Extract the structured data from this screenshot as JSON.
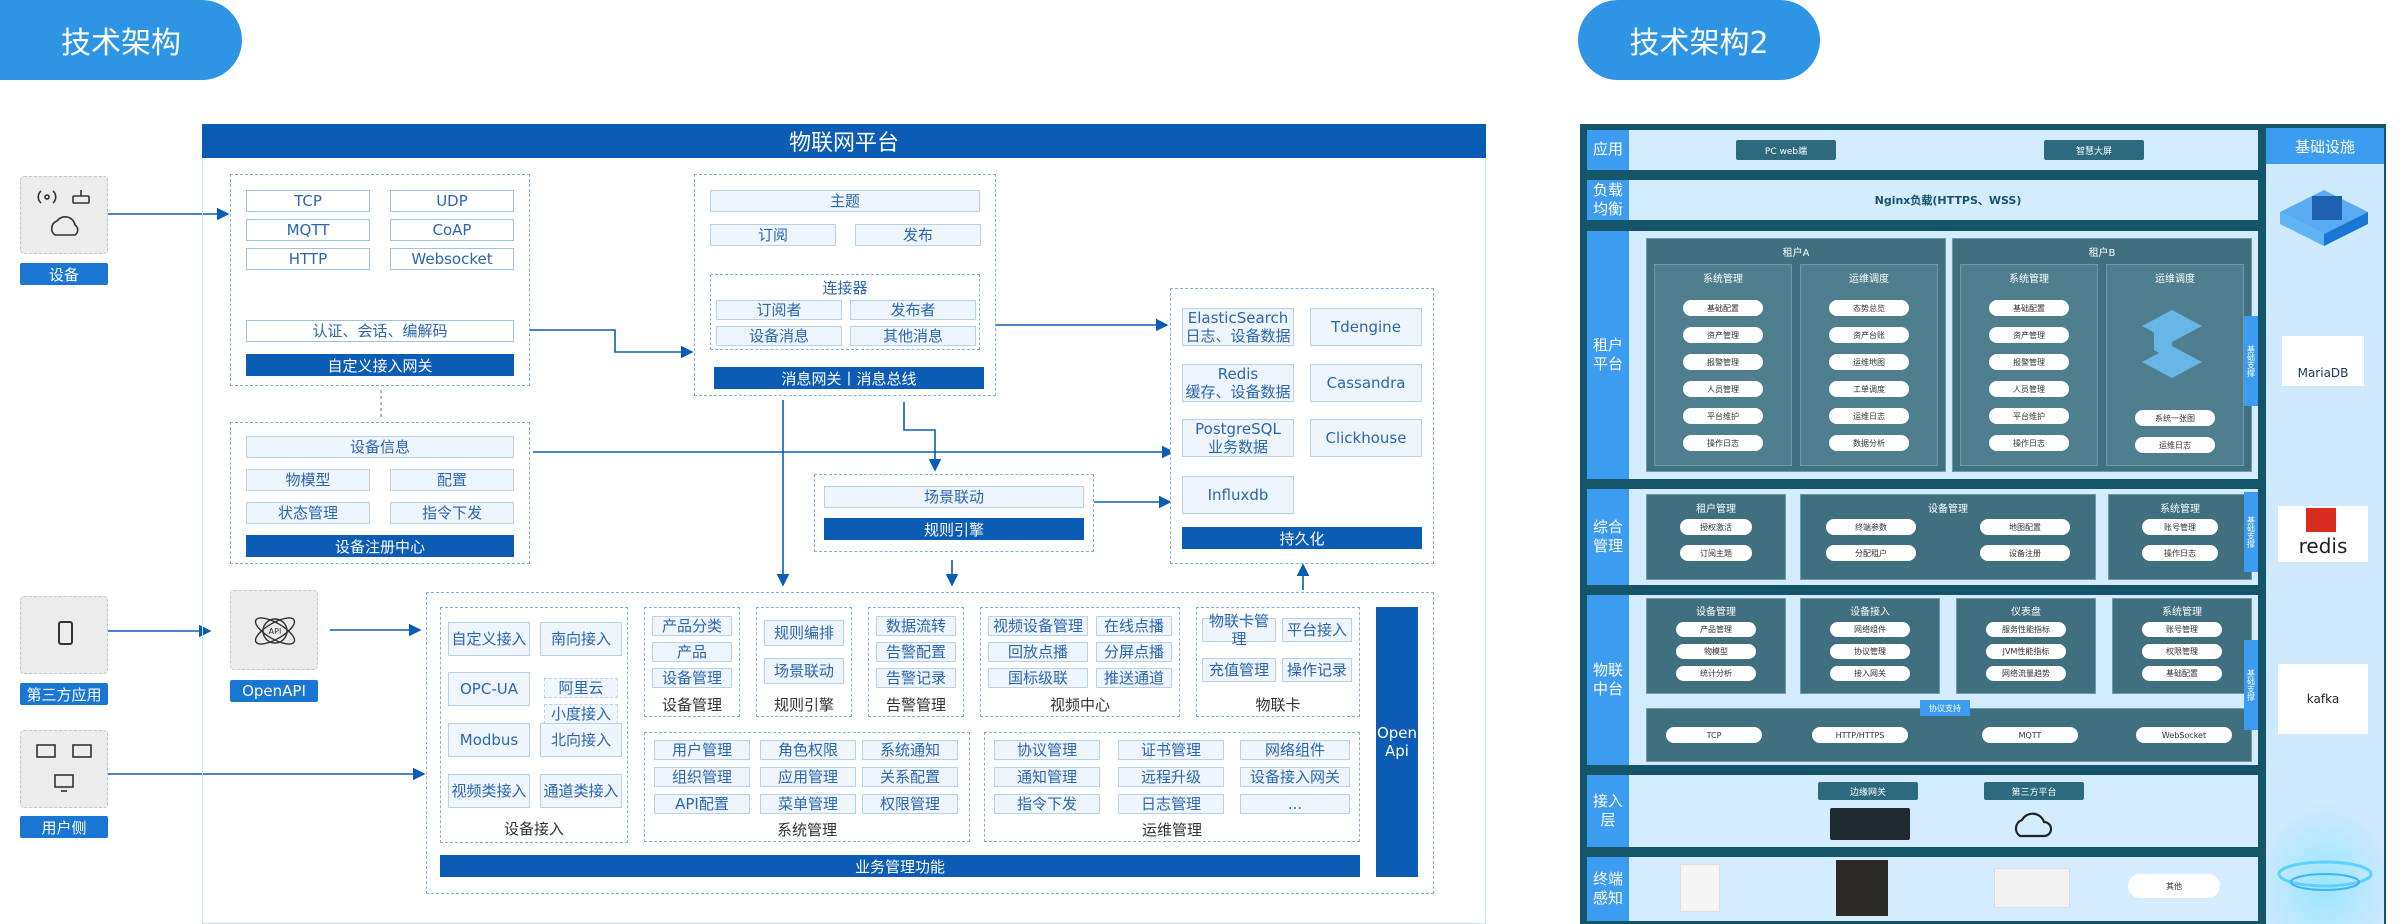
{
  "titles": {
    "left": "技术架构",
    "right": "技术架构2"
  },
  "left": {
    "platform": "物联网平台",
    "devices": {
      "device": "设备",
      "third": "第三方应用",
      "user": "用户侧",
      "openapi": "OpenAPI"
    },
    "gateway": {
      "tcp": "TCP",
      "udp": "UDP",
      "mqtt": "MQTT",
      "coap": "CoAP",
      "http": "HTTP",
      "ws": "Websocket",
      "auth": "认证、会话、编解码",
      "bar": "自定义接入网关"
    },
    "registry": {
      "info": "设备信息",
      "model": "物模型",
      "config": "配置",
      "state": "状态管理",
      "cmd": "指令下发",
      "bar": "设备注册中心"
    },
    "bus": {
      "topic": "主题",
      "sub": "订阅",
      "pub": "发布",
      "conn": "连接器",
      "subscriber": "订阅者",
      "publisher": "发布者",
      "devmsg": "设备消息",
      "other": "其他消息",
      "bar": "消息网关丨消息总线"
    },
    "rule": {
      "link": "场景联动",
      "bar": "规则引擎"
    },
    "persist": {
      "es": "ElasticSearch\n日志、设备数据",
      "td": "Tdengine",
      "redis": "Redis\n缓存、设备数据",
      "cass": "Cassandra",
      "pg": "PostgreSQL\n业务数据",
      "ch": "Clickhouse",
      "influx": "Influxdb",
      "bar": "持久化"
    },
    "access": {
      "custom": "自定义接入",
      "south": "南向接入",
      "opc": "OPC-UA",
      "ali": "阿里云",
      "baidu": "小度接入",
      "modbus": "Modbus",
      "north": "北向接入",
      "video": "视频类接入",
      "channel": "通道类接入",
      "cap": "设备接入"
    },
    "devmgmt": {
      "a": "产品分类",
      "b": "产品",
      "c": "设备管理",
      "cap": "设备管理"
    },
    "ruleeng": {
      "a": "规则编排",
      "b": "场景联动",
      "cap": "规则引擎"
    },
    "alarm": {
      "a": "数据流转",
      "b": "告警配置",
      "c": "告警记录",
      "cap": "告警管理"
    },
    "vcenter": {
      "a": "视频设备管理",
      "b": "在线点播",
      "c": "回放点播",
      "d": "分屏点播",
      "e": "国标级联",
      "f": "推送通道",
      "cap": "视频中心"
    },
    "card": {
      "a": "物联卡管理",
      "b": "平台接入",
      "c": "充值管理",
      "d": "操作记录",
      "cap": "物联卡"
    },
    "sys": {
      "a": "用户管理",
      "b": "角色权限",
      "c": "系统通知",
      "d": "组织管理",
      "e": "应用管理",
      "f": "关系配置",
      "g": "API配置",
      "h": "菜单管理",
      "i": "权限管理",
      "cap": "系统管理"
    },
    "ops": {
      "a": "协议管理",
      "b": "证书管理",
      "c": "网络组件",
      "d": "通知管理",
      "e": "远程升级",
      "f": "设备接入网关",
      "g": "指令下发",
      "h": "日志管理",
      "i": "...",
      "cap": "运维管理"
    },
    "openapi_bar": "Open\nApi",
    "biz_bar": "业务管理功能"
  },
  "right": {
    "infra": "基础设施",
    "rows": {
      "app": "应用",
      "lb": "负载\n均衡",
      "tenant": "租户\n平台",
      "mgmt": "综合\n管理",
      "iot": "物联\n中台",
      "access": "接入\n层",
      "sense": "终端\n感知"
    },
    "app": {
      "pc": "PC web端",
      "screen": "智慧大屏"
    },
    "lb": "Nginx负载(HTTPS、WSS)",
    "tenantA": "租户A",
    "tenantB": "租户B",
    "sysmgmt": "系统管理",
    "opsmgmt": "运维调度",
    "sysItems": [
      "基础配置",
      "资产管理",
      "报警管理",
      "人员管理",
      "平台维护",
      "操作日志"
    ],
    "opsItems": [
      "态势总览",
      "资产台账",
      "运维地图",
      "工单调度",
      "运维日志",
      "数据分析"
    ],
    "opsItemsB": [
      "系统一张图",
      "运维日志"
    ],
    "side": {
      "s1": "基础支撑",
      "s2": "基础支撑",
      "s3": "基础支撑"
    },
    "mgmt": {
      "tenant": "租户管理",
      "t1": "授权激活",
      "t2": "订阅主题",
      "dev": "设备管理",
      "d1": "终端参数",
      "d2": "分配租户",
      "d3": "地图配置",
      "d4": "设备注册",
      "sys": "系统管理",
      "s1": "账号管理",
      "s2": "操作日志"
    },
    "iot": {
      "dev": "设备管理",
      "dev1": "产品管理",
      "dev2": "物模型",
      "dev3": "统计分析",
      "acc": "设备接入",
      "acc1": "网络组件",
      "acc2": "协议管理",
      "acc3": "接入网关",
      "dash": "仪表盘",
      "dash1": "服务性能指标",
      "dash2": "JVM性能指标",
      "dash3": "网络流量趋势",
      "sys": "系统管理",
      "sys1": "账号管理",
      "sys2": "权限管理",
      "sys3": "基础配置",
      "proto": "协议支持",
      "p1": "TCP",
      "p2": "HTTP/HTTPS",
      "p3": "MQTT",
      "p4": "WebSocket"
    },
    "accessLayer": {
      "edge": "边缘网关",
      "third": "第三方平台"
    },
    "sense": {
      "other": "其他"
    },
    "logos": {
      "maria": "MariaDB",
      "redis": "redis",
      "kafka": "kafka"
    }
  }
}
